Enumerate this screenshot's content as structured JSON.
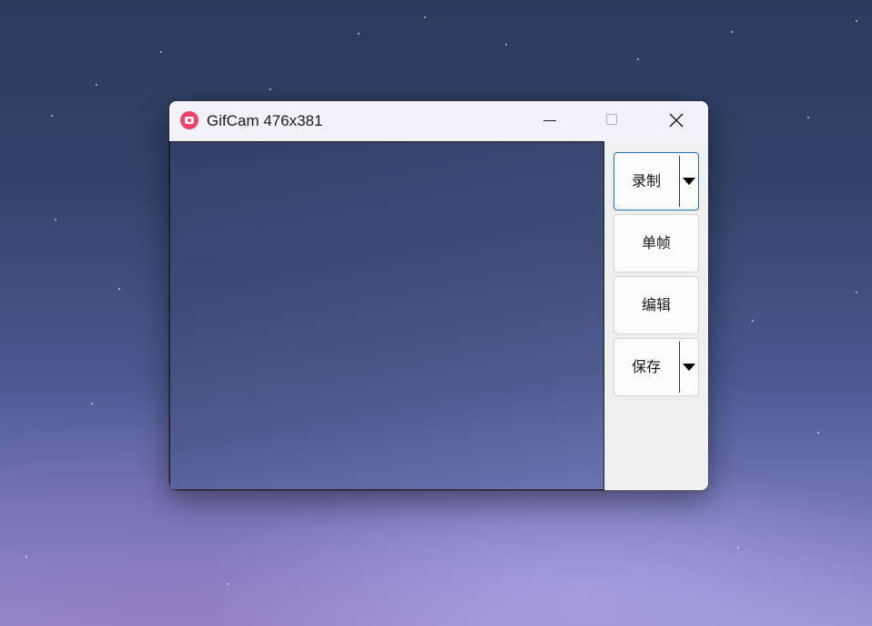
{
  "window": {
    "title": "GifCam 476x381",
    "app_icon": "camera-icon",
    "caption_buttons": {
      "minimize": "minimize-icon",
      "maximize": "maximize-icon",
      "close": "close-icon"
    }
  },
  "side_panel": {
    "record_label": "录制",
    "frame_label": "单帧",
    "edit_label": "编辑",
    "save_label": "保存",
    "dropdown_icon": "caret-down-icon"
  },
  "colors": {
    "app_icon": "#f0406a",
    "focus_border": "#1f6fb5",
    "titlebar": "#f2f2f8"
  }
}
